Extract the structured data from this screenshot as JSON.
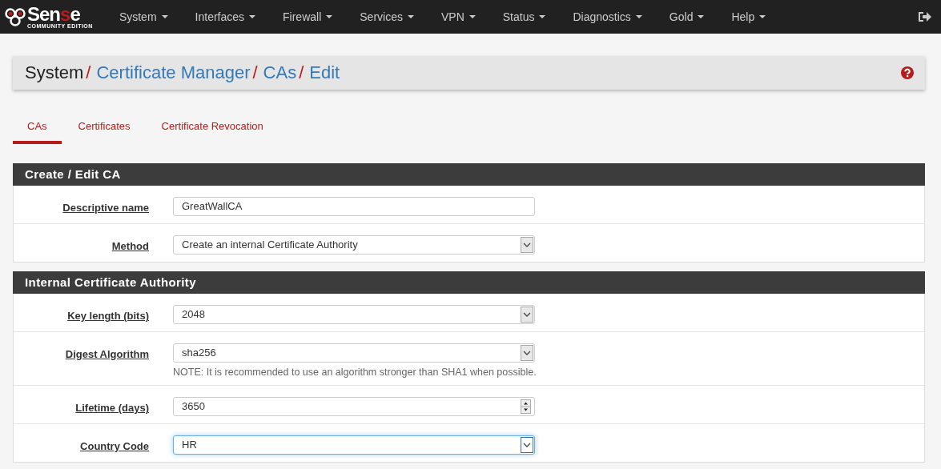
{
  "logo": {
    "name_parts": [
      {
        "text": "Sen",
        "accent": false
      },
      {
        "text": "s",
        "accent": true
      },
      {
        "text": "e",
        "accent": false
      }
    ],
    "edition": "COMMUNITY EDITION"
  },
  "nav": [
    {
      "label": "System"
    },
    {
      "label": "Interfaces"
    },
    {
      "label": "Firewall"
    },
    {
      "label": "Services"
    },
    {
      "label": "VPN"
    },
    {
      "label": "Status"
    },
    {
      "label": "Diagnostics"
    },
    {
      "label": "Gold"
    },
    {
      "label": "Help"
    }
  ],
  "breadcrumb": [
    {
      "label": "System",
      "link": false,
      "separator": "/"
    },
    {
      "label": "Certificate Manager",
      "link": true,
      "separator": "/"
    },
    {
      "label": "CAs",
      "link": true,
      "separator": "/"
    },
    {
      "label": "Edit",
      "link": true
    }
  ],
  "tabs": [
    {
      "label": "CAs",
      "selected": true
    },
    {
      "label": "Certificates",
      "selected": false
    },
    {
      "label": "Certificate Revocation",
      "selected": false
    }
  ],
  "panels": [
    {
      "title": "Create / Edit CA",
      "fields": [
        {
          "label": "Descriptive name",
          "kind": "text",
          "value": "GreatWallCA",
          "focused": false
        },
        {
          "label": "Method",
          "kind": "select",
          "value": "Create an internal Certificate Authority",
          "focused": false
        }
      ]
    },
    {
      "title": "Internal Certificate Authority",
      "fields": [
        {
          "label": "Key length (bits)",
          "kind": "select",
          "value": "2048",
          "focused": false
        },
        {
          "label": "Digest Algorithm",
          "kind": "select",
          "value": "sha256",
          "focused": false,
          "note": "NOTE: It is recommended to use an algorithm stronger than SHA1 when possible."
        },
        {
          "label": "Lifetime (days)",
          "kind": "number",
          "value": "3650",
          "focused": false
        },
        {
          "label": "Country Code",
          "kind": "select",
          "value": "HR",
          "focused": true
        }
      ]
    }
  ]
}
